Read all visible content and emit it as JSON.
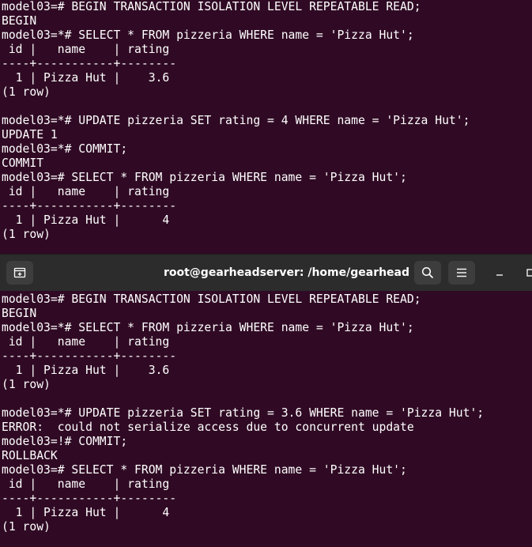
{
  "top_terminal": {
    "lines": [
      "model03=# BEGIN TRANSACTION ISOLATION LEVEL REPEATABLE READ;",
      "BEGIN",
      "model03=*# SELECT * FROM pizzeria WHERE name = 'Pizza Hut';",
      " id |   name    | rating",
      "----+-----------+--------",
      "  1 | Pizza Hut |    3.6",
      "(1 row)",
      "",
      "model03=*# UPDATE pizzeria SET rating = 4 WHERE name = 'Pizza Hut';",
      "UPDATE 1",
      "model03=*# COMMIT;",
      "COMMIT",
      "model03=# SELECT * FROM pizzeria WHERE name = 'Pizza Hut';",
      " id |   name    | rating",
      "----+-----------+--------",
      "  1 | Pizza Hut |      4",
      "(1 row)"
    ]
  },
  "headerbar": {
    "title": "root@gearheadserver: /home/gearhead",
    "new_tab_icon": "new-tab-icon",
    "search_icon": "search-icon",
    "menu_icon": "hamburger-menu-icon",
    "minimize_icon": "minimize-icon",
    "maximize_icon": "maximize-icon"
  },
  "bottom_terminal": {
    "lines": [
      "model03=# BEGIN TRANSACTION ISOLATION LEVEL REPEATABLE READ;",
      "BEGIN",
      "model03=*# SELECT * FROM pizzeria WHERE name = 'Pizza Hut';",
      " id |   name    | rating",
      "----+-----------+--------",
      "  1 | Pizza Hut |    3.6",
      "(1 row)",
      "",
      "model03=*# UPDATE pizzeria SET rating = 3.6 WHERE name = 'Pizza Hut';",
      "ERROR:  could not serialize access due to concurrent update",
      "model03=!# COMMIT;",
      "ROLLBACK",
      "model03=# SELECT * FROM pizzeria WHERE name = 'Pizza Hut';",
      " id |   name    | rating",
      "----+-----------+--------",
      "  1 | Pizza Hut |      4",
      "(1 row)"
    ]
  },
  "colors": {
    "terminal_background": "#300a24",
    "terminal_text": "#ffffff",
    "headerbar_background": "#2c2c2c",
    "button_background": "#3d3d3d"
  }
}
